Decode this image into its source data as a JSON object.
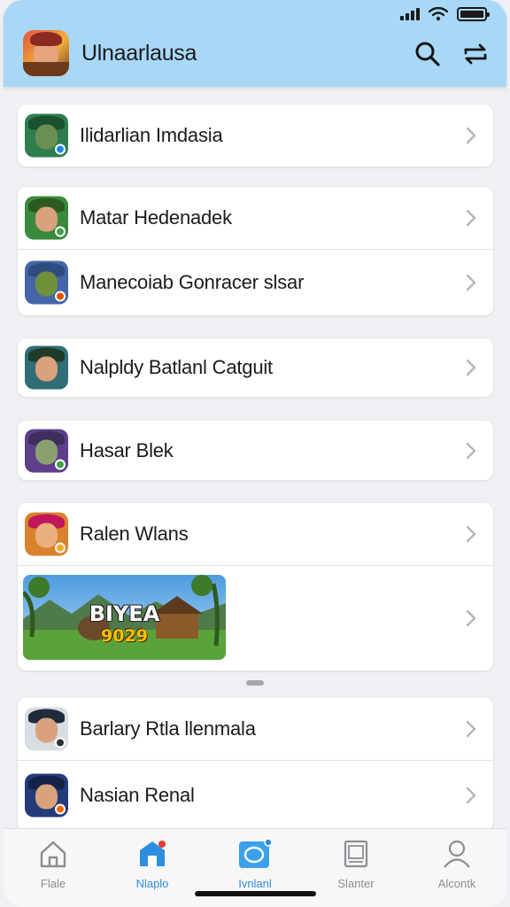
{
  "app": {
    "title": "Ulnaarlausa"
  },
  "header": {
    "search_icon": "search-icon",
    "filter_icon": "sort-icon"
  },
  "groups": [
    {
      "items": [
        {
          "label": "Ilidarlian Imdasia",
          "avatar_color": "#2e7d4f"
        }
      ]
    },
    {
      "items": [
        {
          "label": "Matar Hedenadek",
          "avatar_color": "#3a8a3e"
        },
        {
          "label": "Manecoiab Gonracer slsar",
          "avatar_color": "#4466a8"
        }
      ]
    },
    {
      "items": [
        {
          "label": "Nalpldy Batlanl Catguit",
          "avatar_color": "#2f6d77"
        }
      ]
    },
    {
      "items": [
        {
          "label": "Hasar Blek",
          "avatar_color": "#5d3f8a"
        }
      ]
    },
    {
      "items": [
        {
          "label": "Ralen Wlans",
          "avatar_color": "#d9822b"
        },
        {
          "banner_title": "BIYEA",
          "banner_year": "9029"
        }
      ]
    },
    {
      "items": [
        {
          "label": "Barlary Rtla llenmala",
          "avatar_color": "#1f2b3a"
        },
        {
          "label": "Nasian Renal",
          "avatar_color": "#243b7a"
        }
      ]
    }
  ],
  "nav": [
    {
      "label": "Flale",
      "icon": "home-icon",
      "active": false
    },
    {
      "label": "Nlaplo",
      "icon": "store-icon",
      "active": true
    },
    {
      "label": "Ivnlanl",
      "icon": "chat-icon",
      "active": true
    },
    {
      "label": "Slanter",
      "icon": "document-icon",
      "active": false
    },
    {
      "label": "Alcontk",
      "icon": "profile-icon",
      "active": false
    }
  ],
  "colors": {
    "header_bg": "#a8d8f6",
    "accent": "#2d8ee0"
  }
}
